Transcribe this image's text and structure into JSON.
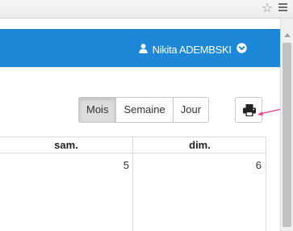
{
  "browser": {
    "star_icon": "☆"
  },
  "navbar": {
    "bg_color": "#1e88d8",
    "user_name": "Nikita ADEMBSKI",
    "user_icon": "user-icon",
    "menu_icon": "chevron-down-circle-icon"
  },
  "toolbar": {
    "views": [
      {
        "label": "Mois",
        "active": true
      },
      {
        "label": "Semaine",
        "active": false
      },
      {
        "label": "Jour",
        "active": false
      }
    ],
    "print_icon": "print-icon"
  },
  "annotation": {
    "color": "#e8438f",
    "points_to": "print-button"
  },
  "calendar": {
    "headers": [
      "sam.",
      "dim."
    ],
    "days": [
      "5",
      "6"
    ]
  }
}
